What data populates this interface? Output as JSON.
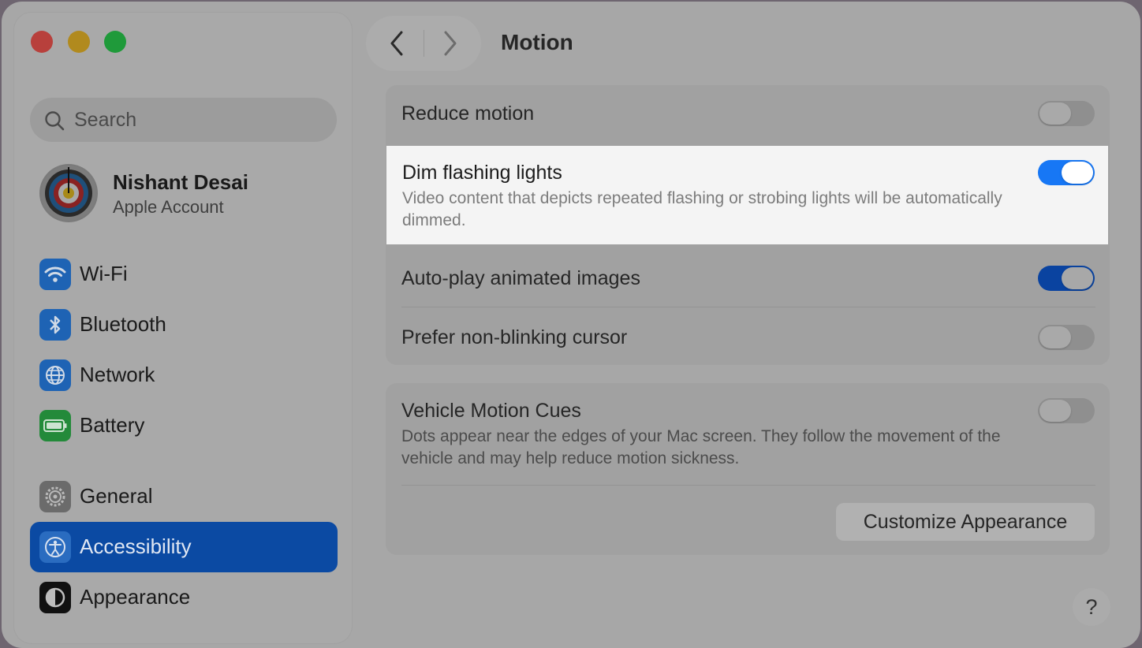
{
  "window": {
    "title": "Motion"
  },
  "search": {
    "placeholder": "Search"
  },
  "account": {
    "name": "Nishant Desai",
    "subtitle": "Apple Account"
  },
  "sidebar": {
    "items": [
      {
        "label": "Wi-Fi",
        "icon": "wifi-icon",
        "color": "#1e63b4"
      },
      {
        "label": "Bluetooth",
        "icon": "bluetooth-icon",
        "color": "#1e63b4"
      },
      {
        "label": "Network",
        "icon": "globe-icon",
        "color": "#1e63b4"
      },
      {
        "label": "Battery",
        "icon": "battery-icon",
        "color": "#238a3a"
      },
      {
        "label": "General",
        "icon": "gear-icon",
        "color": "#6b6b6b"
      },
      {
        "label": "Accessibility",
        "icon": "accessibility-icon",
        "color": "#1e63b4",
        "selected": true
      },
      {
        "label": "Appearance",
        "icon": "appearance-icon",
        "color": "#111111"
      }
    ]
  },
  "settings": {
    "reduce_motion": {
      "label": "Reduce motion",
      "on": false
    },
    "dim_flashing": {
      "label": "Dim flashing lights",
      "description": "Video content that depicts repeated flashing or strobing lights will be automatically dimmed.",
      "on": true
    },
    "autoplay": {
      "label": "Auto-play animated images",
      "on": true
    },
    "non_blinking": {
      "label": "Prefer non-blinking cursor",
      "on": false
    },
    "vehicle": {
      "label": "Vehicle Motion Cues",
      "description": "Dots appear near the edges of your Mac screen. They follow the movement of the vehicle and may help reduce motion sickness.",
      "on": false
    },
    "customize_button": "Customize Appearance"
  },
  "help": {
    "label": "?"
  },
  "colors": {
    "accent": "#1777f5",
    "selected_row": "#0b4aa3"
  }
}
